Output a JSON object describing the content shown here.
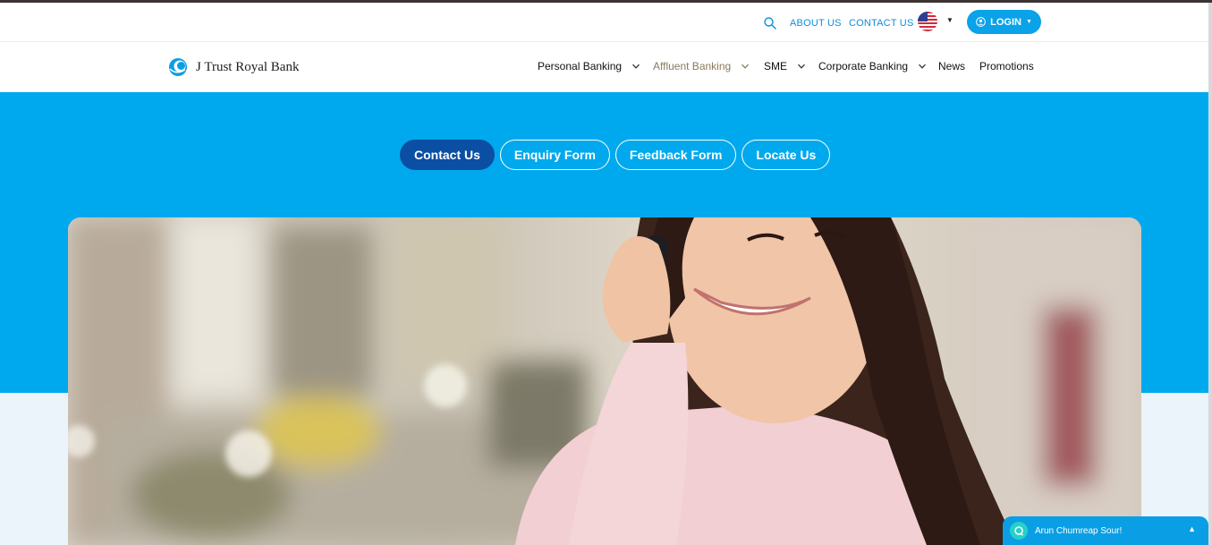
{
  "utility": {
    "about_us": "ABOUT US",
    "contact_us": "CONTACT US",
    "language_flag": "us-flag-icon",
    "login_label": "LOGIN"
  },
  "brand": {
    "name": "J Trust Royal Bank"
  },
  "nav": {
    "items": [
      {
        "label": "Personal Banking",
        "has_dropdown": true,
        "active": false
      },
      {
        "label": "Affluent Banking",
        "has_dropdown": true,
        "active": true
      },
      {
        "label": "SME",
        "has_dropdown": true,
        "active": false
      },
      {
        "label": "Corporate Banking",
        "has_dropdown": true,
        "active": false
      },
      {
        "label": "News",
        "has_dropdown": false,
        "active": false
      },
      {
        "label": "Promotions",
        "has_dropdown": false,
        "active": false
      }
    ]
  },
  "tabs": [
    {
      "label": "Contact Us",
      "active": true
    },
    {
      "label": "Enquiry Form",
      "active": false
    },
    {
      "label": "Feedback Form",
      "active": false
    },
    {
      "label": "Locate Us",
      "active": false
    }
  ],
  "chat": {
    "label": "Arun Chumreap Sour!"
  },
  "colors": {
    "hero_blue": "#00a9ed",
    "tab_active": "#0a4fa3",
    "link_blue": "#0d8fd8",
    "nav_active": "#8a7a5c"
  }
}
